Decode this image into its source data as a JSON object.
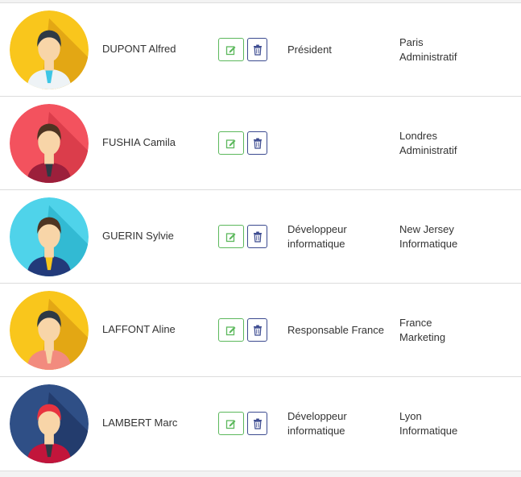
{
  "employees": [
    {
      "name": "DUPONT Alfred",
      "avatar": {
        "bg": "#f9c61c",
        "shade": "#e0a314",
        "hair": "#2e3a45",
        "skin": "#f8d5a8",
        "top": "#eef3f6",
        "tie": "#3cc6e6"
      },
      "poste": [
        "Président"
      ],
      "lieu": "Paris",
      "service": "Administratif"
    },
    {
      "name": "FUSHIA Camila",
      "avatar": {
        "bg": "#f3525e",
        "shade": "#d83b49",
        "hair": "#4e3422",
        "skin": "#f8d5a8",
        "top": "#9c1f3b",
        "tie": "#2e3a45"
      },
      "poste": [],
      "lieu": "Londres",
      "service": "Administratif"
    },
    {
      "name": "GUERIN Sylvie",
      "avatar": {
        "bg": "#4fd3ea",
        "shade": "#2fb7d0",
        "hair": "#4e3422",
        "skin": "#f8d5a8",
        "top": "#223a7a",
        "tie": "#f9c61c"
      },
      "poste": [
        "Développeur",
        "informatique"
      ],
      "lieu": "New Jersey",
      "service": "Informatique"
    },
    {
      "name": "LAFFONT Aline",
      "avatar": {
        "bg": "#f9c61c",
        "shade": "#e0a314",
        "hair": "#2e3a45",
        "skin": "#f8d5a8",
        "top": "#f28b7e",
        "tie": "#f8d5a8"
      },
      "poste": [
        "Responsable France"
      ],
      "lieu": "France",
      "service": "Marketing"
    },
    {
      "name": "LAMBERT Marc",
      "avatar": {
        "bg": "#2f4f86",
        "shade": "#223a6a",
        "hair": "#e8333f",
        "skin": "#f8d5a8",
        "top": "#c2153b",
        "tie": "#2e3a45"
      },
      "poste": [
        "Développeur",
        "informatique"
      ],
      "lieu": "Lyon",
      "service": "Informatique"
    }
  ],
  "icons": {
    "edit": "edit-icon",
    "delete": "trash-icon"
  },
  "colors": {
    "edit_border": "#5cb85c",
    "delete_border": "#3b4a8f"
  }
}
